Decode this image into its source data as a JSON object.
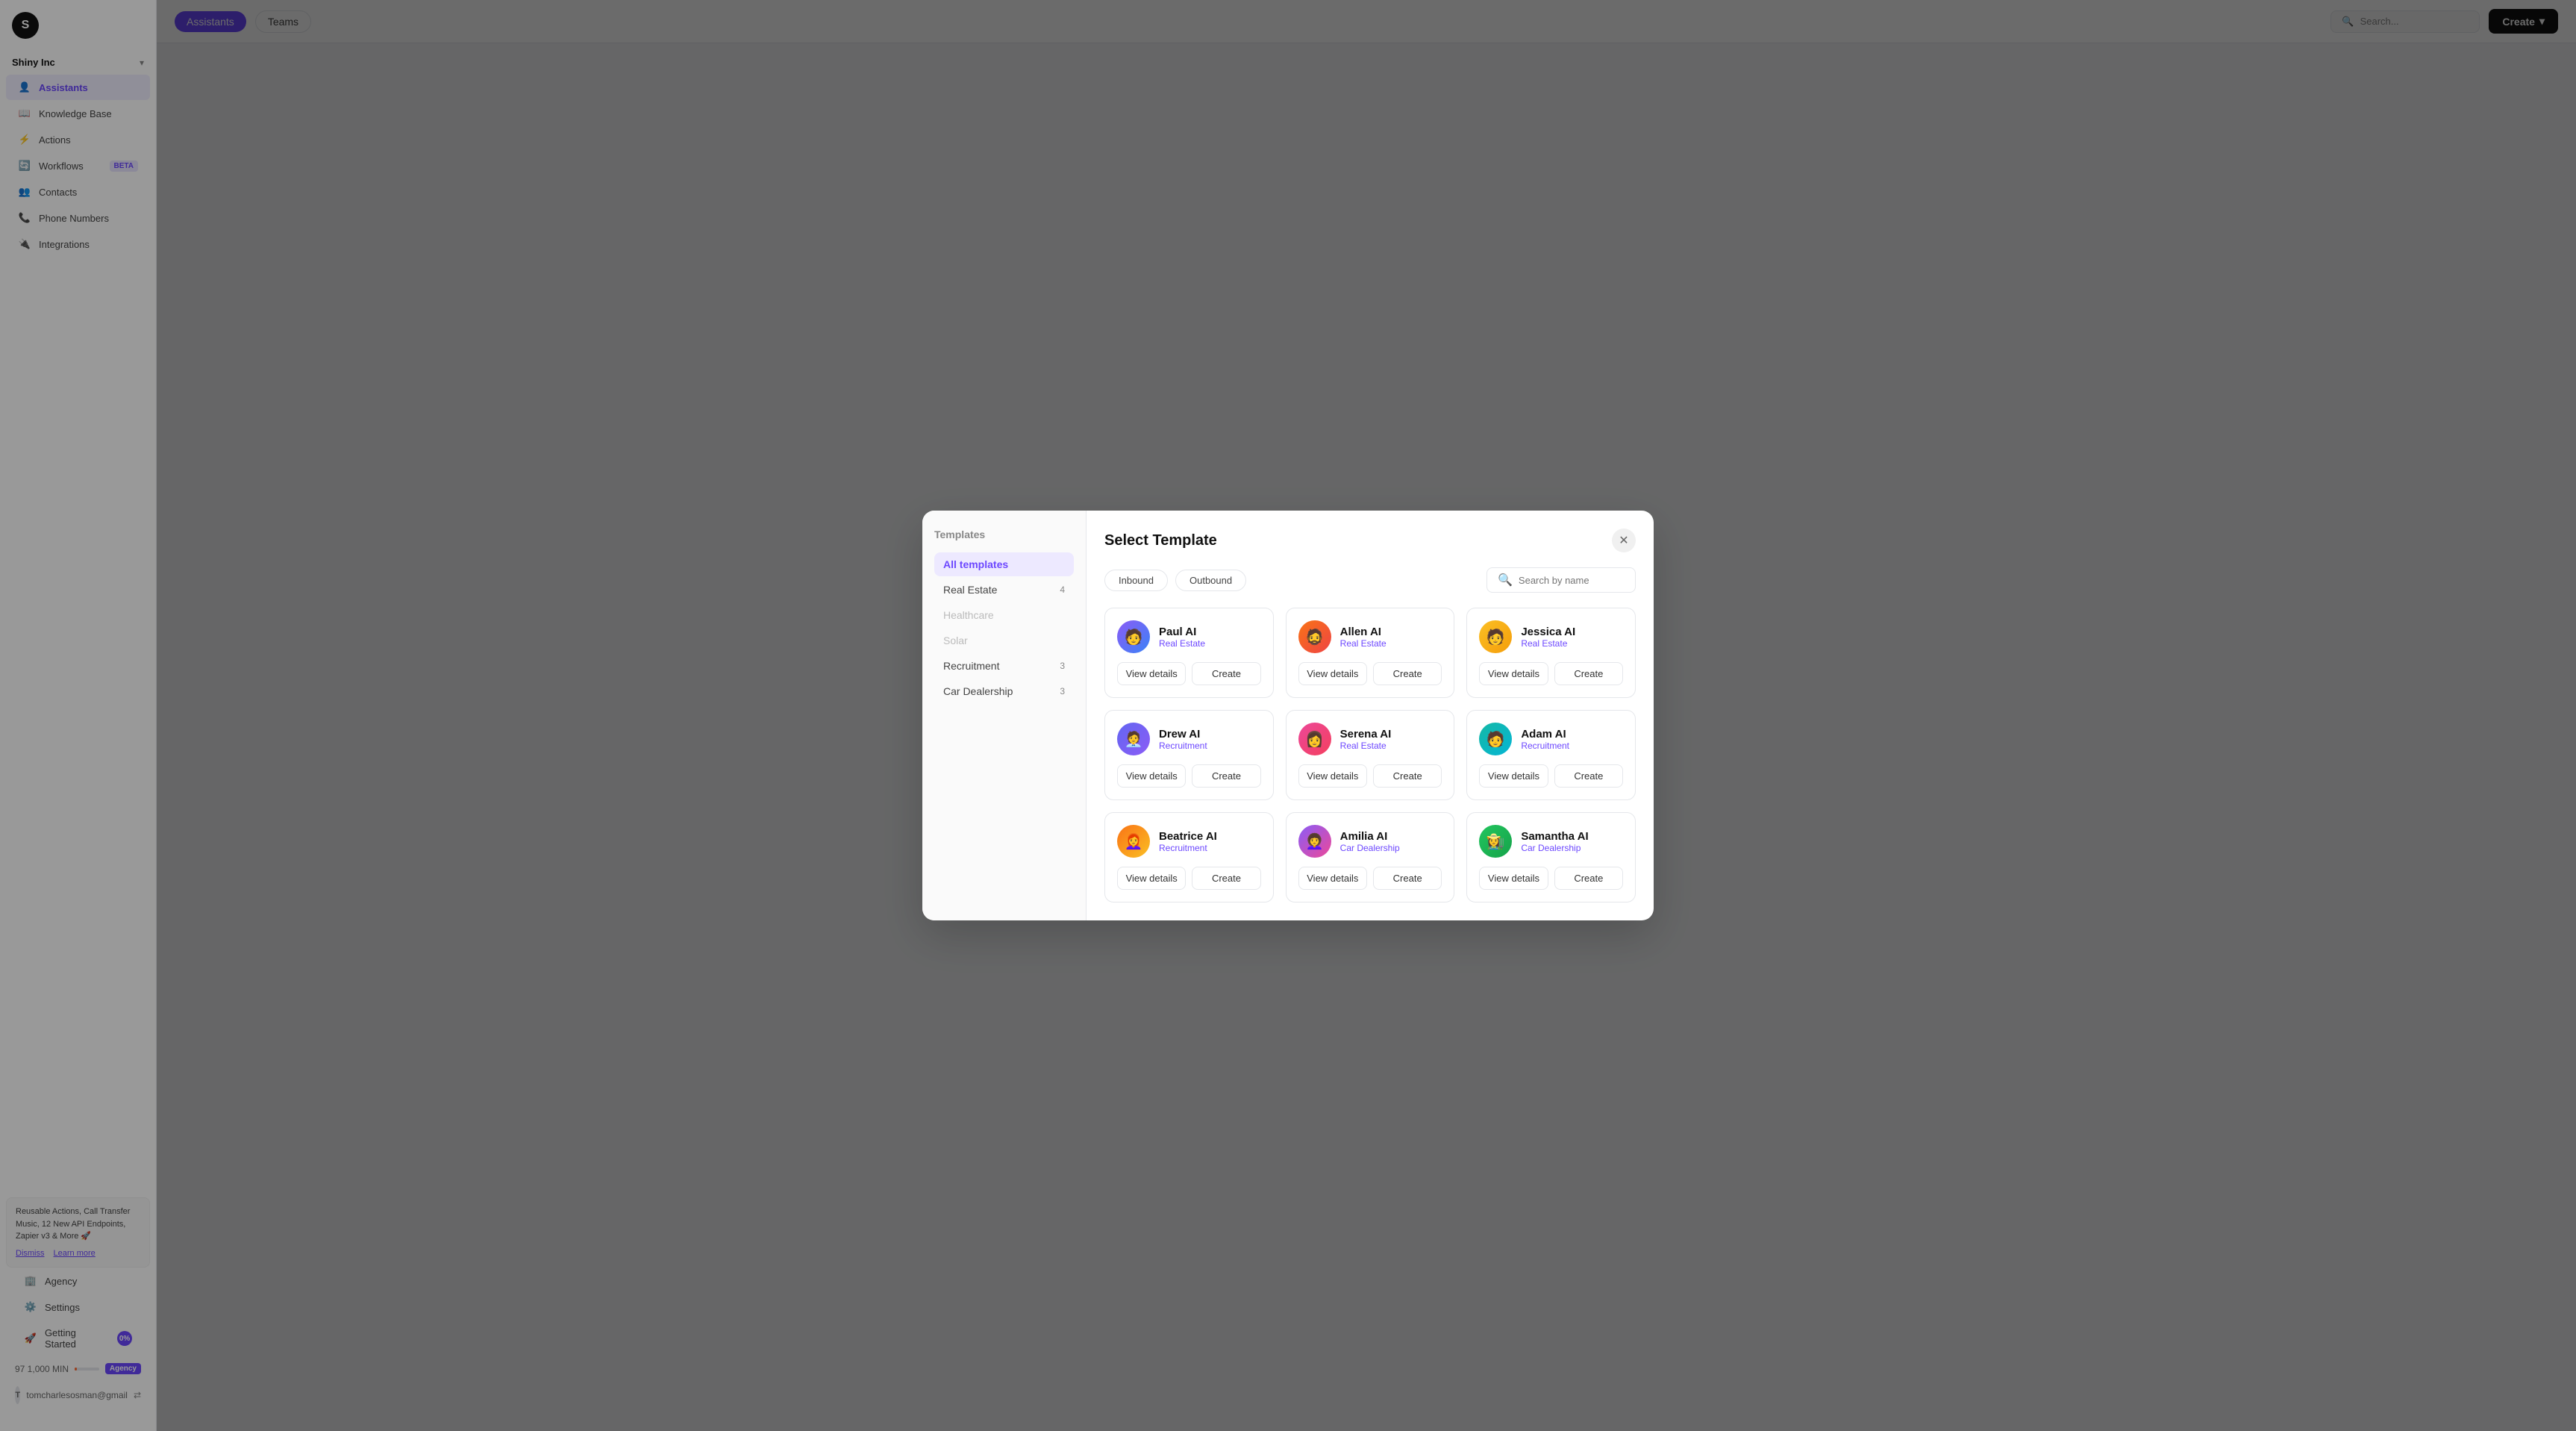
{
  "sidebar": {
    "logo_letter": "S",
    "company": "Shiny Inc",
    "nav_items": [
      {
        "id": "assistants",
        "label": "Assistants",
        "icon": "👤",
        "active": true
      },
      {
        "id": "knowledge-base",
        "label": "Knowledge Base",
        "icon": "📖"
      },
      {
        "id": "actions",
        "label": "Actions",
        "icon": "⚡"
      },
      {
        "id": "workflows",
        "label": "Workflows",
        "icon": "🔄",
        "badge": "BETA"
      },
      {
        "id": "contacts",
        "label": "Contacts",
        "icon": "👥"
      },
      {
        "id": "phone-numbers",
        "label": "Phone Numbers",
        "icon": "📞"
      },
      {
        "id": "integrations",
        "label": "Integrations",
        "icon": "🔌"
      }
    ],
    "bottom_nav": [
      {
        "id": "agency",
        "label": "Agency",
        "icon": "🏢"
      },
      {
        "id": "settings",
        "label": "Settings",
        "icon": "⚙️"
      },
      {
        "id": "getting-started",
        "label": "Getting Started",
        "icon": "🚀",
        "badge": "0%"
      }
    ],
    "notification": {
      "text": "Reusable Actions, Call Transfer Music, 12 New API Endpoints, Zapier v3 & More 🚀",
      "dismiss": "Dismiss",
      "learn_more": "Learn more"
    },
    "progress": {
      "label": "97  1,000 MIN",
      "badge": "Agency"
    },
    "user": "tomcharlesosman@gmail"
  },
  "header": {
    "tabs": [
      {
        "id": "assistants",
        "label": "Assistants",
        "active": true
      },
      {
        "id": "teams",
        "label": "Teams",
        "active": false
      }
    ],
    "search_placeholder": "Search...",
    "create_label": "Create",
    "create_icon": "▾"
  },
  "modal": {
    "title": "Select Template",
    "close_icon": "✕",
    "sidebar": {
      "section_title": "Templates",
      "items": [
        {
          "id": "all",
          "label": "All templates",
          "count": null,
          "active": true
        },
        {
          "id": "real-estate",
          "label": "Real Estate",
          "count": "4",
          "active": false
        },
        {
          "id": "healthcare",
          "label": "Healthcare",
          "count": null,
          "active": false,
          "disabled": true
        },
        {
          "id": "solar",
          "label": "Solar",
          "count": null,
          "active": false,
          "disabled": true
        },
        {
          "id": "recruitment",
          "label": "Recruitment",
          "count": "3",
          "active": false
        },
        {
          "id": "car-dealership",
          "label": "Car Dealership",
          "count": "3",
          "active": false
        }
      ]
    },
    "filters": [
      {
        "id": "inbound",
        "label": "Inbound"
      },
      {
        "id": "outbound",
        "label": "Outbound"
      }
    ],
    "search_placeholder": "Search by name",
    "templates": [
      {
        "id": "paul-ai",
        "name": "Paul AI",
        "category": "Real Estate",
        "avatar_class": "av-paul",
        "avatar_emoji": "🧑",
        "view_details": "View details",
        "create": "Create"
      },
      {
        "id": "allen-ai",
        "name": "Allen AI",
        "category": "Real Estate",
        "avatar_class": "av-allen",
        "avatar_emoji": "🧔",
        "view_details": "View details",
        "create": "Create"
      },
      {
        "id": "jessica-ai",
        "name": "Jessica AI",
        "category": "Real Estate",
        "avatar_class": "av-jessica",
        "avatar_emoji": "👩‍🦱",
        "view_details": "View details",
        "create": "Create"
      },
      {
        "id": "drew-ai",
        "name": "Drew AI",
        "category": "Recruitment",
        "avatar_class": "av-drew",
        "avatar_emoji": "🧑‍💼",
        "view_details": "View details",
        "create": "Create"
      },
      {
        "id": "serena-ai",
        "name": "Serena AI",
        "category": "Real Estate",
        "avatar_class": "av-serena",
        "avatar_emoji": "👩",
        "view_details": "View details",
        "create": "Create"
      },
      {
        "id": "adam-ai",
        "name": "Adam AI",
        "category": "Recruitment",
        "avatar_class": "av-adam",
        "avatar_emoji": "🧑",
        "view_details": "View details",
        "create": "Create"
      },
      {
        "id": "beatrice-ai",
        "name": "Beatrice AI",
        "category": "Recruitment",
        "avatar_class": "av-beatrice",
        "avatar_emoji": "👩‍🦰",
        "view_details": "View details",
        "create": "Create"
      },
      {
        "id": "amilia-ai",
        "name": "Amilia AI",
        "category": "Car Dealership",
        "avatar_class": "av-amilia",
        "avatar_emoji": "👩‍🦱",
        "view_details": "View details",
        "create": "Create"
      },
      {
        "id": "samantha-ai",
        "name": "Samantha AI",
        "category": "Car Dealership",
        "avatar_class": "av-samantha",
        "avatar_emoji": "👩‍🌾",
        "view_details": "View details",
        "create": "Create"
      }
    ]
  }
}
